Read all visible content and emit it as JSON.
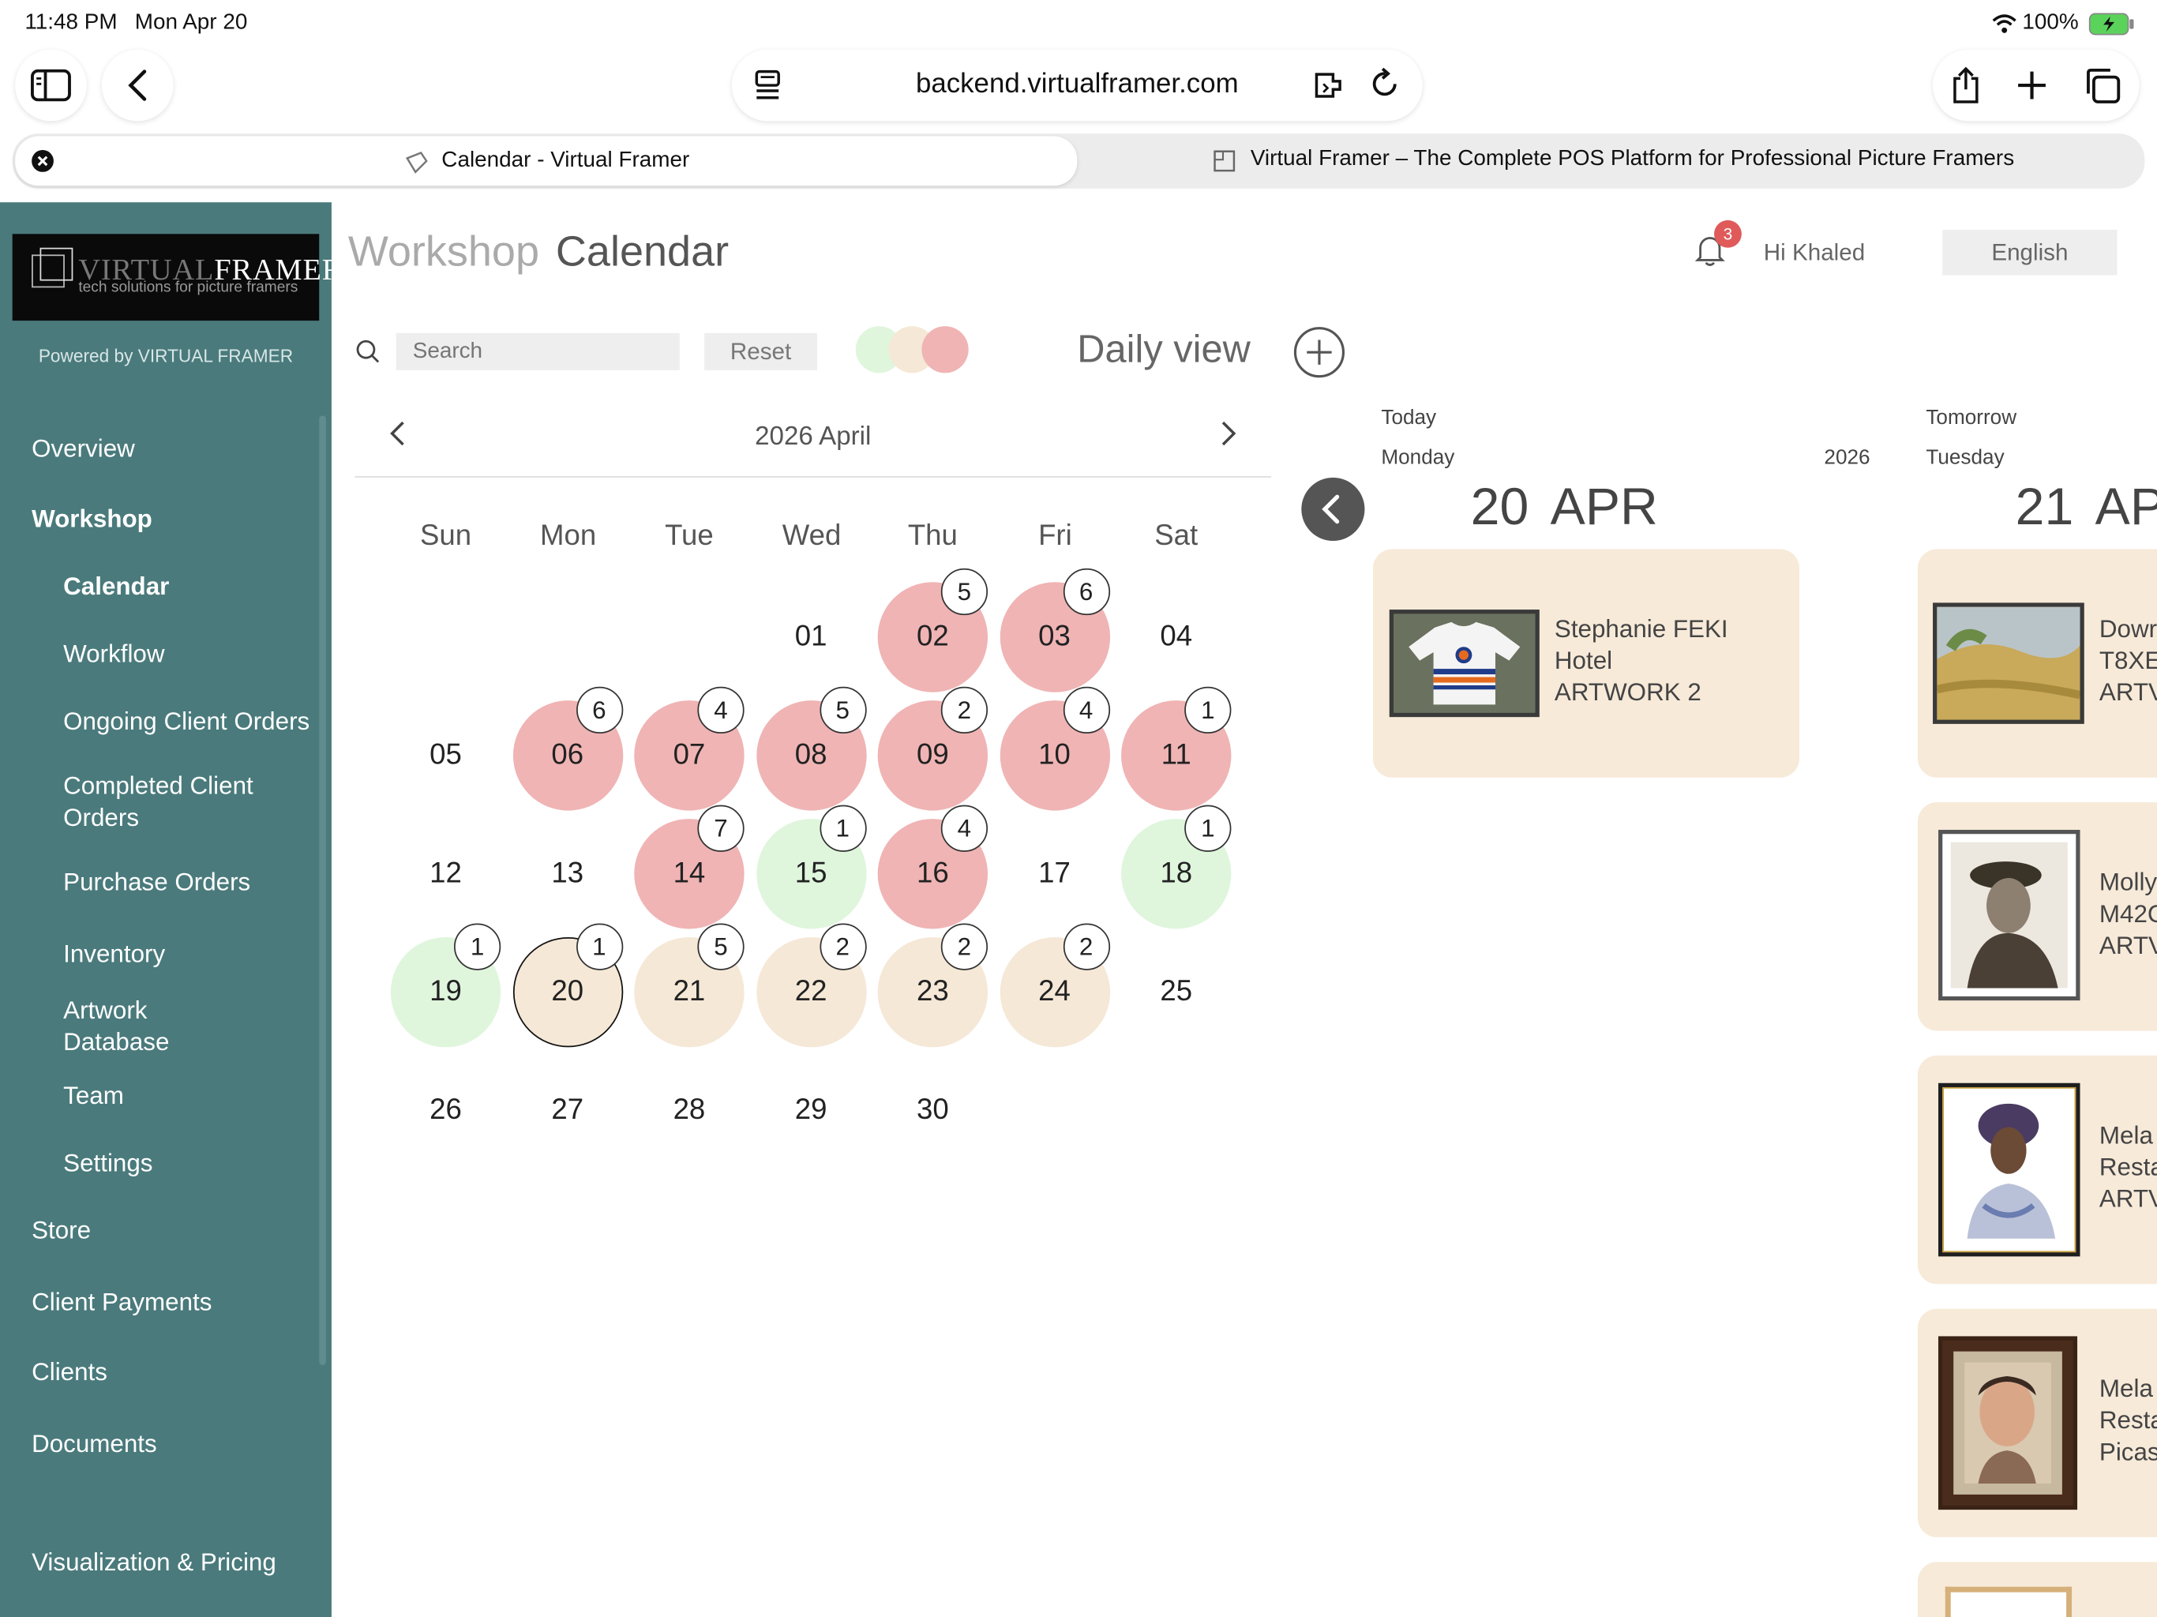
{
  "status_bar": {
    "time": "11:48 PM",
    "date": "Mon Apr 20",
    "battery": "100%"
  },
  "browser": {
    "url": "backend.virtualframer.com",
    "tabs": [
      {
        "title": "Calendar - Virtual Framer"
      },
      {
        "title": "Virtual Framer – The Complete POS Platform for Professional Picture Framers"
      }
    ]
  },
  "sidebar": {
    "logo": {
      "part1": "VIRTUAL",
      "part2": "FRAMER",
      "tagline": "tech solutions for picture framers"
    },
    "powered_by": "Powered by VIRTUAL FRAMER",
    "items": [
      "Overview",
      "Workshop",
      "Calendar",
      "Workflow",
      "Ongoing Client Orders",
      "Completed Client Orders",
      "Purchase Orders",
      "Inventory",
      "Artwork Database",
      "Team",
      "Settings",
      "Store",
      "Client Payments",
      "Clients",
      "Documents",
      "Visualization & Pricing"
    ]
  },
  "header": {
    "title_light": "Workshop",
    "title_dark": "Calendar",
    "notification_count": "3",
    "greeting": "Hi Khaled",
    "language": "English"
  },
  "toolbar": {
    "search_placeholder": "Search",
    "reset": "Reset",
    "view_label": "Daily view"
  },
  "calendar": {
    "month_label": "2026 April",
    "weekdays": [
      "Sun",
      "Mon",
      "Tue",
      "Wed",
      "Thu",
      "Fri",
      "Sat"
    ],
    "days": [
      {
        "d": "01",
        "status": "none",
        "count": ""
      },
      {
        "d": "02",
        "status": "red",
        "count": "5"
      },
      {
        "d": "03",
        "status": "red",
        "count": "6"
      },
      {
        "d": "04",
        "status": "none",
        "count": ""
      },
      {
        "d": "05",
        "status": "none",
        "count": ""
      },
      {
        "d": "06",
        "status": "red",
        "count": "6"
      },
      {
        "d": "07",
        "status": "red",
        "count": "4"
      },
      {
        "d": "08",
        "status": "red",
        "count": "5"
      },
      {
        "d": "09",
        "status": "red",
        "count": "2"
      },
      {
        "d": "10",
        "status": "red",
        "count": "4"
      },
      {
        "d": "11",
        "status": "red",
        "count": "1"
      },
      {
        "d": "12",
        "status": "none",
        "count": ""
      },
      {
        "d": "13",
        "status": "none",
        "count": ""
      },
      {
        "d": "14",
        "status": "red",
        "count": "7"
      },
      {
        "d": "15",
        "status": "green",
        "count": "1"
      },
      {
        "d": "16",
        "status": "red",
        "count": "4"
      },
      {
        "d": "17",
        "status": "none",
        "count": ""
      },
      {
        "d": "18",
        "status": "green",
        "count": "1"
      },
      {
        "d": "19",
        "status": "green",
        "count": "1"
      },
      {
        "d": "20",
        "status": "cream-today",
        "count": "1"
      },
      {
        "d": "21",
        "status": "cream",
        "count": "5"
      },
      {
        "d": "22",
        "status": "cream",
        "count": "2"
      },
      {
        "d": "23",
        "status": "cream",
        "count": "2"
      },
      {
        "d": "24",
        "status": "cream",
        "count": "2"
      },
      {
        "d": "25",
        "status": "none",
        "count": ""
      },
      {
        "d": "26",
        "status": "none",
        "count": ""
      },
      {
        "d": "27",
        "status": "none",
        "count": ""
      },
      {
        "d": "28",
        "status": "none",
        "count": ""
      },
      {
        "d": "29",
        "status": "none",
        "count": ""
      },
      {
        "d": "30",
        "status": "none",
        "count": ""
      }
    ],
    "colors": {
      "red": "#f0b4b4",
      "green": "#dff6dd",
      "cream": "#f5e8d7"
    }
  },
  "daily": {
    "today": {
      "label": "Today",
      "weekday": "Monday",
      "year": "2026",
      "day": "20",
      "month": "APR",
      "cards": [
        {
          "line1": "Stephanie FEKI",
          "line2": "Hotel",
          "line3": "ARTWORK 2"
        }
      ]
    },
    "tomorrow": {
      "label": "Tomorrow",
      "weekday": "Tuesday",
      "day": "21",
      "month": "AP",
      "cards": [
        {
          "line1": "Dowr",
          "line2": "T8XE",
          "line3": "ARTV"
        },
        {
          "line1": "Molly",
          "line2": "M42C",
          "line3": "ARTV"
        },
        {
          "line1": "Mela",
          "line2": "Resta",
          "line3": "ARTV"
        },
        {
          "line1": "Mela",
          "line2": "Resta",
          "line3": "Picas"
        }
      ]
    }
  }
}
